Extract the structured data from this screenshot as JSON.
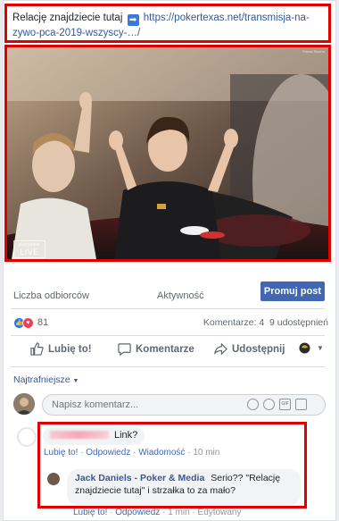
{
  "post": {
    "text_prefix": "Relację znajdziecie tutaj",
    "link_text": "https://pokertexas.net/transmisja-na-zywo-pca-2019-wszyscy-…/",
    "photo_credit": "Tomas Stacha",
    "watermark_brand": "partypoker",
    "watermark_live": "LIVE"
  },
  "insights": {
    "reach_label": "Liczba odbiorców",
    "activity_label": "Aktywność",
    "promote_label": "Promuj post"
  },
  "reactions": {
    "count": "81",
    "comments_label": "Komentarze: 4",
    "shares_label": "9 udostępnień"
  },
  "actions": {
    "like": "Lubię to!",
    "comment": "Komentarze",
    "share": "Udostępnij"
  },
  "comments": {
    "sort_label": "Najtrafniejsze",
    "input_placeholder": "Napisz komentarz...",
    "c1": {
      "text": "Link?",
      "like": "Lubię to!",
      "reply": "Odpowiedz",
      "message": "Wiadomość",
      "time": "10 min"
    },
    "c2": {
      "author": "Jack Daniels - Poker & Media",
      "text": "Serio?? \"Relację znajdziecie tutaj\" i strzałka to za mało?",
      "like": "Lubię to!",
      "reply": "Odpowiedz",
      "time": "1 min",
      "edited": "Edytowany"
    }
  },
  "colors": {
    "highlight_red": "#e00000",
    "facebook_blue": "#4267b2",
    "link_blue": "#365899"
  }
}
